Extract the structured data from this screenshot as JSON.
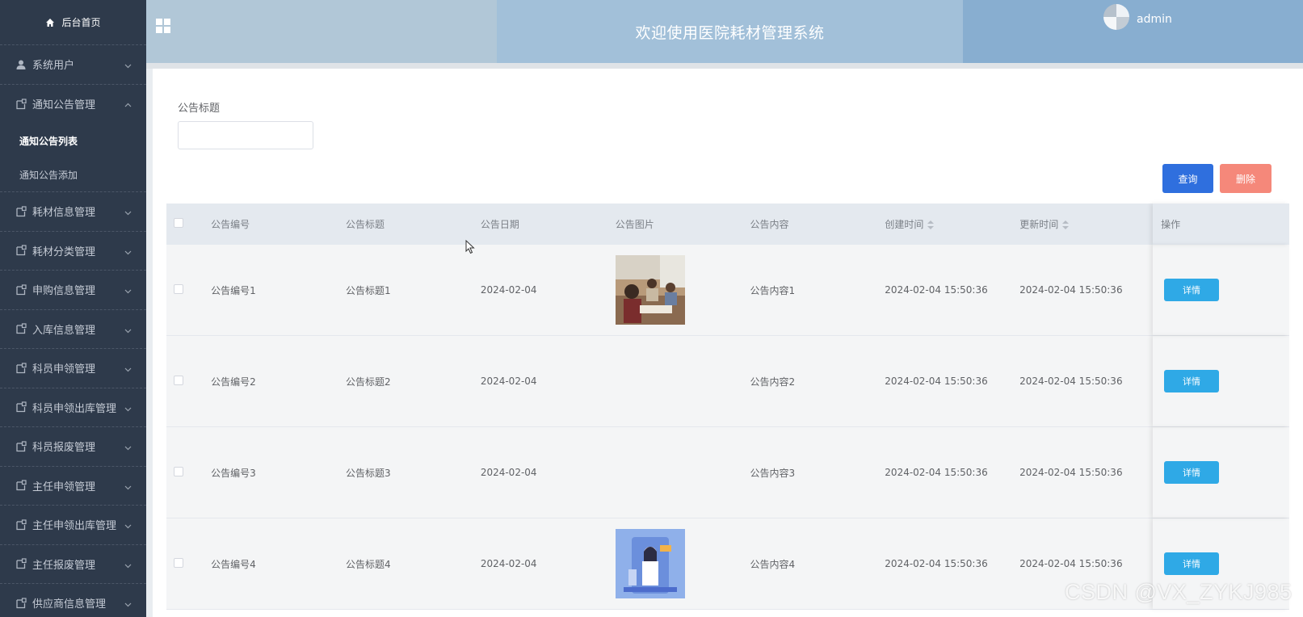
{
  "sidebar": {
    "home_label": "后台首页",
    "items": [
      {
        "label": "系统用户",
        "icon": "user-icon",
        "expanded": false
      },
      {
        "label": "通知公告管理",
        "icon": "note-icon",
        "expanded": true,
        "children": [
          {
            "label": "通知公告列表",
            "active": true
          },
          {
            "label": "通知公告添加",
            "active": false
          }
        ]
      },
      {
        "label": "耗材信息管理",
        "icon": "note-icon",
        "expanded": false
      },
      {
        "label": "耗材分类管理",
        "icon": "note-icon",
        "expanded": false
      },
      {
        "label": "申购信息管理",
        "icon": "note-icon",
        "expanded": false
      },
      {
        "label": "入库信息管理",
        "icon": "note-icon",
        "expanded": false
      },
      {
        "label": "科员申领管理",
        "icon": "note-icon",
        "expanded": false
      },
      {
        "label": "科员申领出库管理",
        "icon": "note-icon",
        "expanded": false
      },
      {
        "label": "科员报废管理",
        "icon": "note-icon",
        "expanded": false
      },
      {
        "label": "主任申领管理",
        "icon": "note-icon",
        "expanded": false
      },
      {
        "label": "主任申领出库管理",
        "icon": "note-icon",
        "expanded": false
      },
      {
        "label": "主任报废管理",
        "icon": "note-icon",
        "expanded": false
      },
      {
        "label": "供应商信息管理",
        "icon": "note-icon",
        "expanded": false
      }
    ]
  },
  "header": {
    "title": "欢迎使用医院耗材管理系统",
    "username": "admin"
  },
  "search": {
    "label": "公告标题",
    "value": "",
    "placeholder": ""
  },
  "actions": {
    "query_label": "查询",
    "delete_label": "删除"
  },
  "table": {
    "columns": [
      "公告编号",
      "公告标题",
      "公告日期",
      "公告图片",
      "公告内容",
      "创建时间",
      "更新时间",
      "操作"
    ],
    "detail_label": "详情",
    "rows": [
      {
        "no": "公告编号1",
        "title": "公告标题1",
        "date": "2024-02-04",
        "image": "classroom-photo",
        "content": "公告内容1",
        "created": "2024-02-04 15:50:36",
        "updated": "2024-02-04 15:50:36"
      },
      {
        "no": "公告编号2",
        "title": "公告标题2",
        "date": "2024-02-04",
        "image": "",
        "content": "公告内容2",
        "created": "2024-02-04 15:50:36",
        "updated": "2024-02-04 15:50:36"
      },
      {
        "no": "公告编号3",
        "title": "公告标题3",
        "date": "2024-02-04",
        "image": "",
        "content": "公告内容3",
        "created": "2024-02-04 15:50:36",
        "updated": "2024-02-04 15:50:36"
      },
      {
        "no": "公告编号4",
        "title": "公告标题4",
        "date": "2024-02-04",
        "image": "doctor-illustration",
        "content": "公告内容4",
        "created": "2024-02-04 15:50:36",
        "updated": "2024-02-04 15:50:36"
      }
    ]
  },
  "watermark": "CSDN @VX_ZYKJ985",
  "colors": {
    "sidebar_bg": "#2e3a4b",
    "query_button": "#2f6fde",
    "delete_button": "#f5887a",
    "detail_button": "#2fa9e6"
  }
}
